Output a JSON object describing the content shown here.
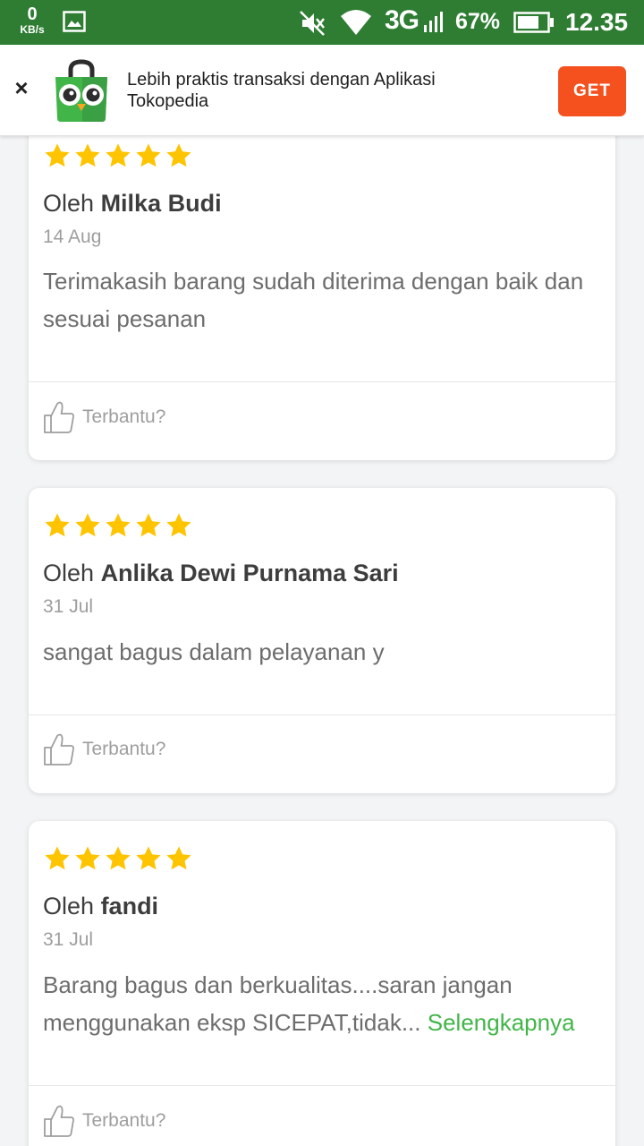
{
  "status_bar": {
    "speed_value": "0",
    "speed_unit": "KB/s",
    "network": "3G",
    "battery": "67%",
    "time": "12.35"
  },
  "app_banner": {
    "close_symbol": "×",
    "message": "Lebih praktis transaksi dengan Aplikasi Tokopedia",
    "get_label": "GET",
    "accent_color": "#f4511e"
  },
  "reviews": [
    {
      "rating": 5,
      "author_prefix": "Oleh",
      "author": "Milka Budi",
      "date": "14 Aug",
      "text": "Terimakasih barang sudah diterima dengan baik dan sesuai pesanan",
      "read_more": "",
      "helpful_label": "Terbantu?"
    },
    {
      "rating": 5,
      "author_prefix": "Oleh",
      "author": "Anlika Dewi Purnama Sari",
      "date": "31 Jul",
      "text": "sangat bagus dalam pelayanan y",
      "read_more": "",
      "helpful_label": "Terbantu?"
    },
    {
      "rating": 5,
      "author_prefix": "Oleh",
      "author": "fandi",
      "date": "31 Jul",
      "text": "Barang bagus dan berkualitas....saran jangan menggunakan eksp SICEPAT,tidak...",
      "read_more": "Selengkapnya",
      "helpful_label": "Terbantu?"
    }
  ],
  "colors": {
    "status_bar": "#2e7d32",
    "star": "#ffc400",
    "link": "#42b549"
  }
}
